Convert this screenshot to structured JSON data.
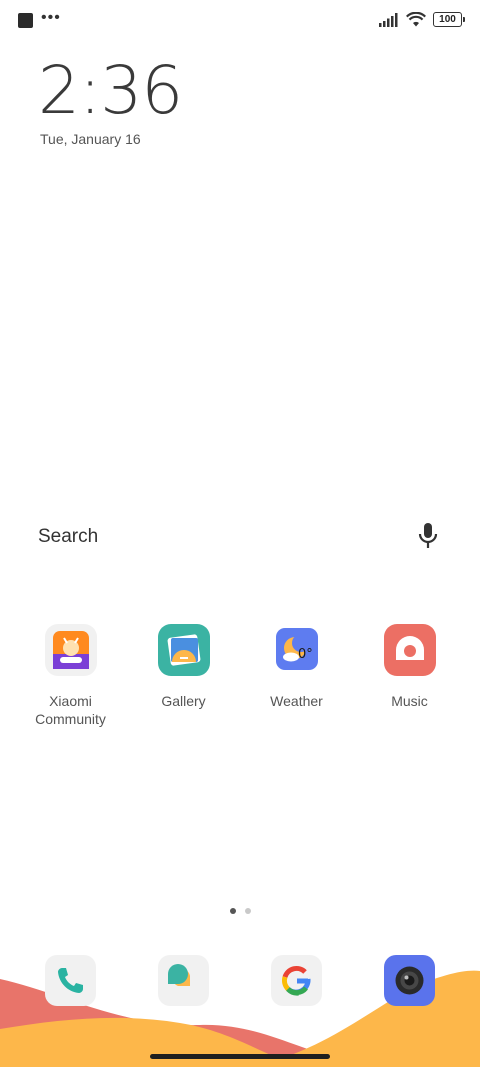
{
  "status_bar": {
    "left_icons": [
      "notification-square-icon",
      "more-dots-icon"
    ],
    "battery_level": "100",
    "right_icons": [
      "signal-icon",
      "wifi-icon",
      "battery-icon"
    ]
  },
  "clock": {
    "time": "2:36",
    "date": "Tue, January 16"
  },
  "search": {
    "label": "Search",
    "icon": "microphone-icon"
  },
  "apps": [
    {
      "label": "Xiaomi\nCommunity",
      "icon": "xiaomi-community-icon"
    },
    {
      "label": "Gallery",
      "icon": "gallery-icon"
    },
    {
      "label": "Weather",
      "icon": "weather-icon",
      "badge": "0°"
    },
    {
      "label": "Music",
      "icon": "music-icon"
    }
  ],
  "pager": {
    "pages": 2,
    "active": 0
  },
  "dock": [
    {
      "name": "phone",
      "icon": "phone-icon"
    },
    {
      "name": "messages",
      "icon": "messages-icon"
    },
    {
      "name": "google",
      "icon": "google-icon"
    },
    {
      "name": "camera",
      "icon": "camera-icon"
    }
  ],
  "colors": {
    "wave_red": "#e8746a",
    "wave_orange": "#fdb74a",
    "gallery_bg": "#3bb3a3",
    "weather_bg": "#5e7cf0",
    "music_bg": "#ec6f64",
    "camera_bg": "#5a73ec"
  }
}
